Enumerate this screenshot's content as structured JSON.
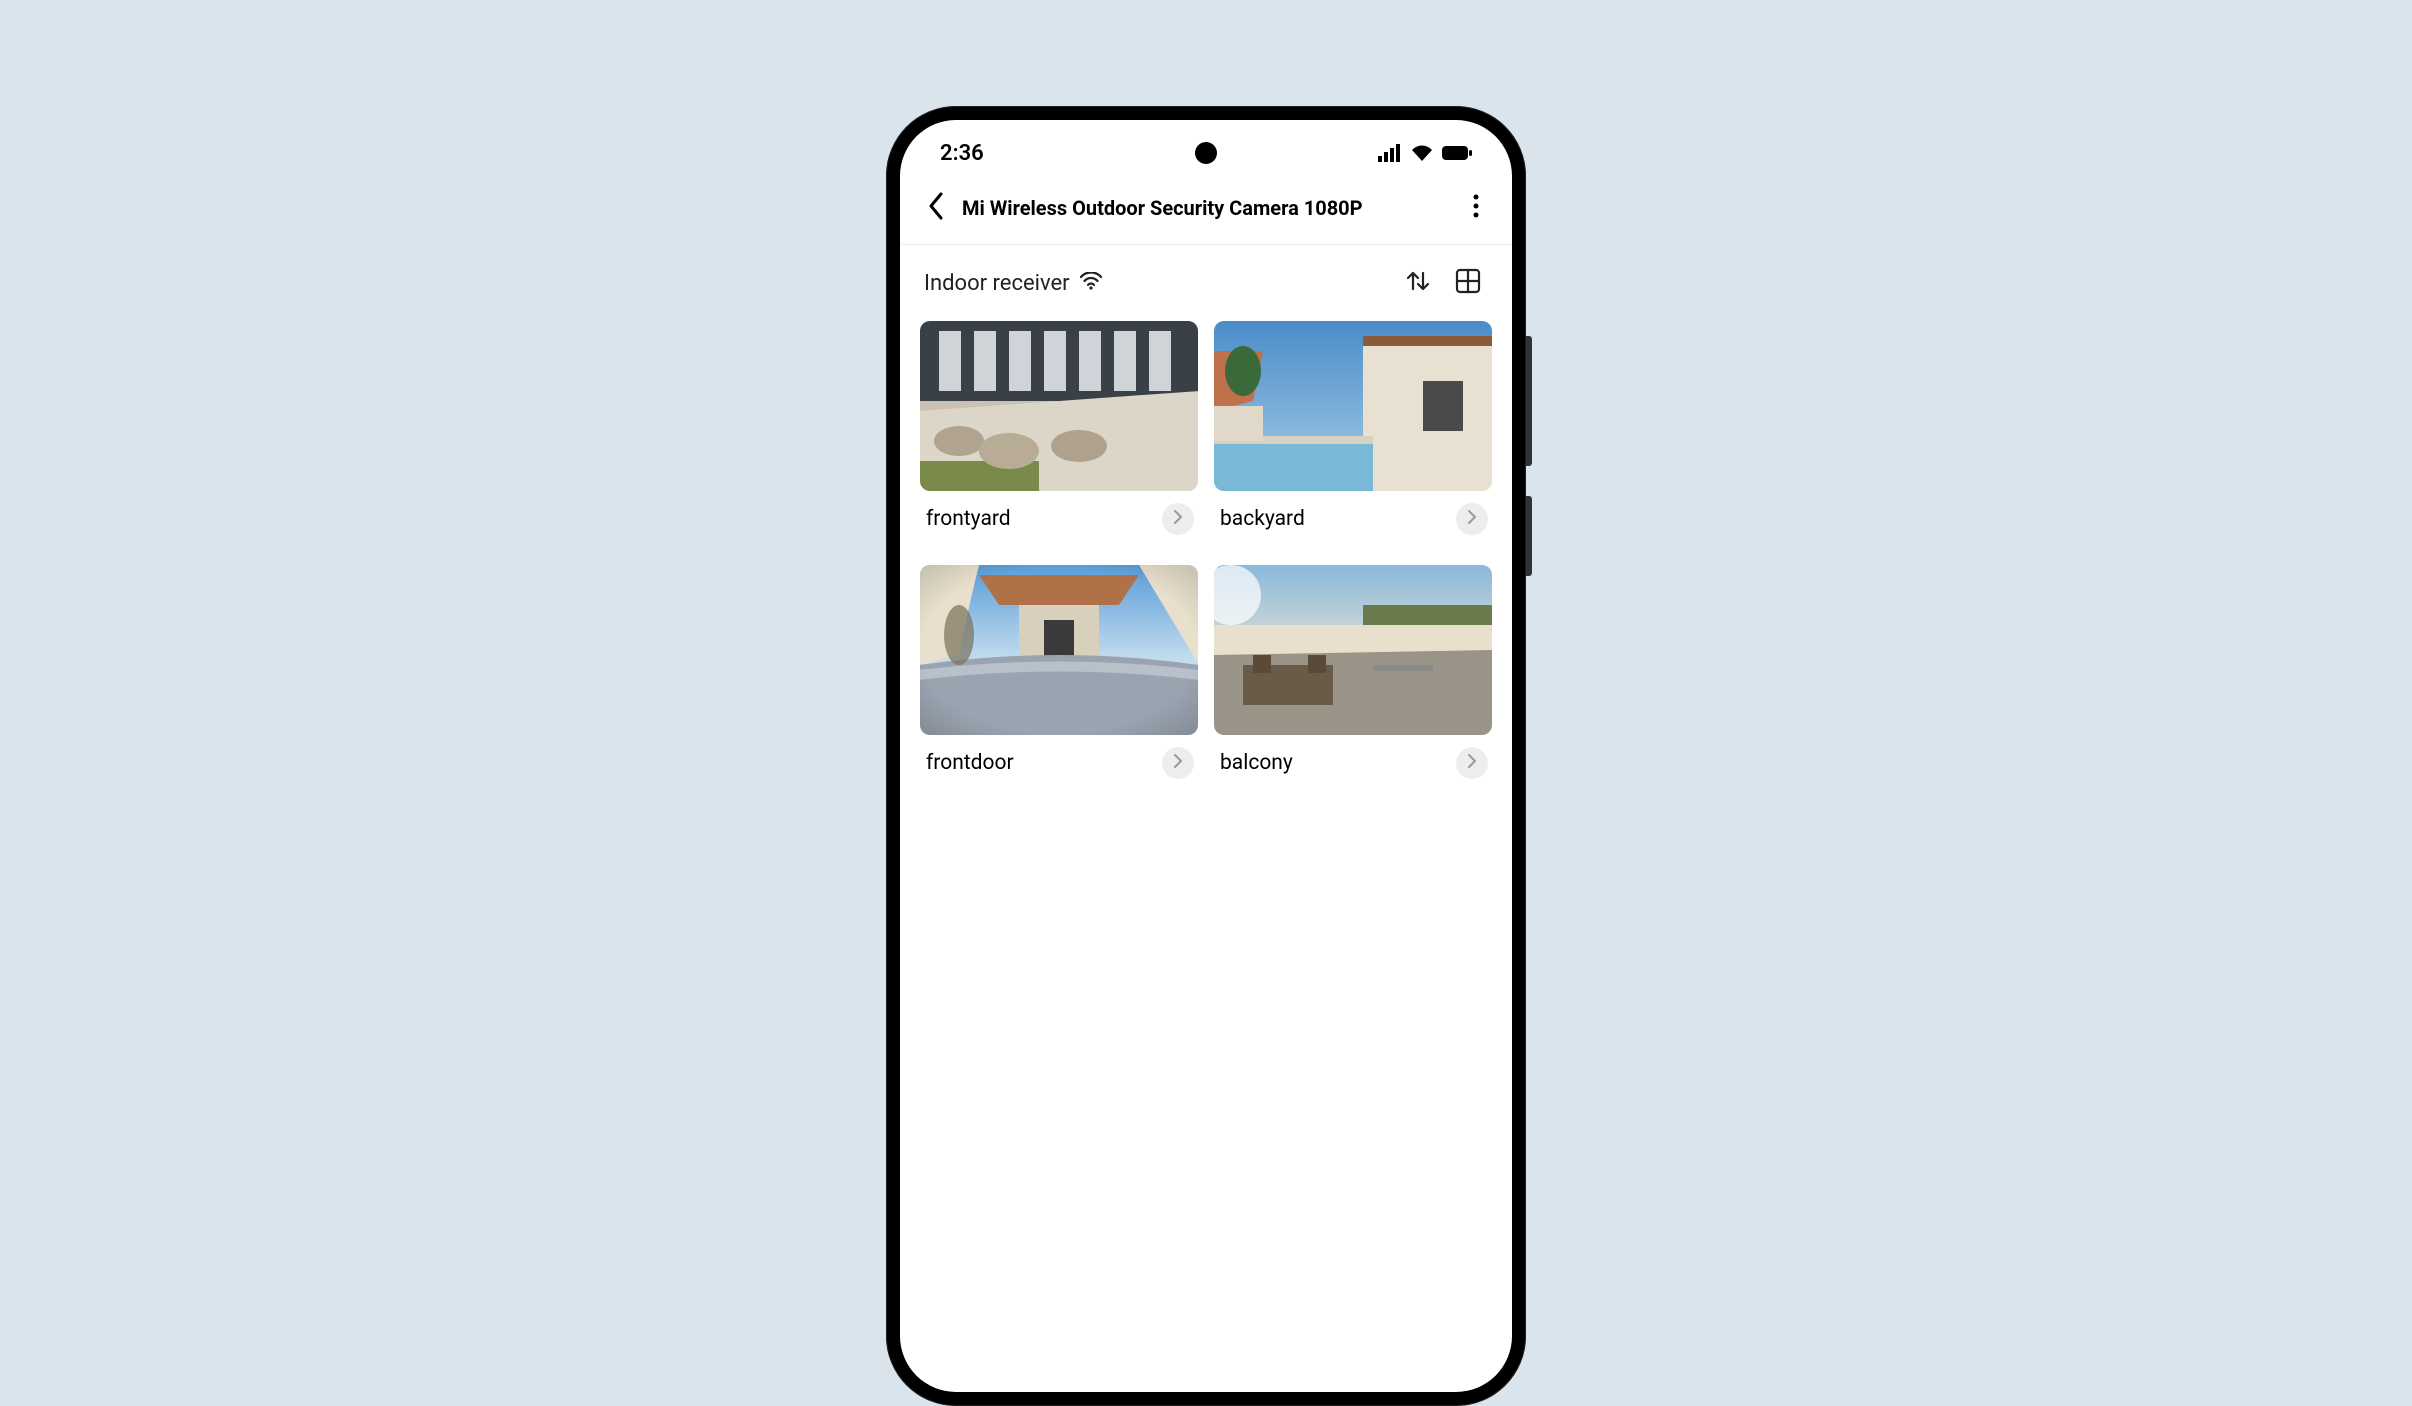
{
  "status": {
    "time": "2:36"
  },
  "header": {
    "title": "Mi Wireless Outdoor Security Camera 1080P"
  },
  "receiver": {
    "label": "Indoor receiver"
  },
  "cameras": [
    {
      "label": "frontyard"
    },
    {
      "label": "backyard"
    },
    {
      "label": "frontdoor"
    },
    {
      "label": "balcony"
    }
  ]
}
